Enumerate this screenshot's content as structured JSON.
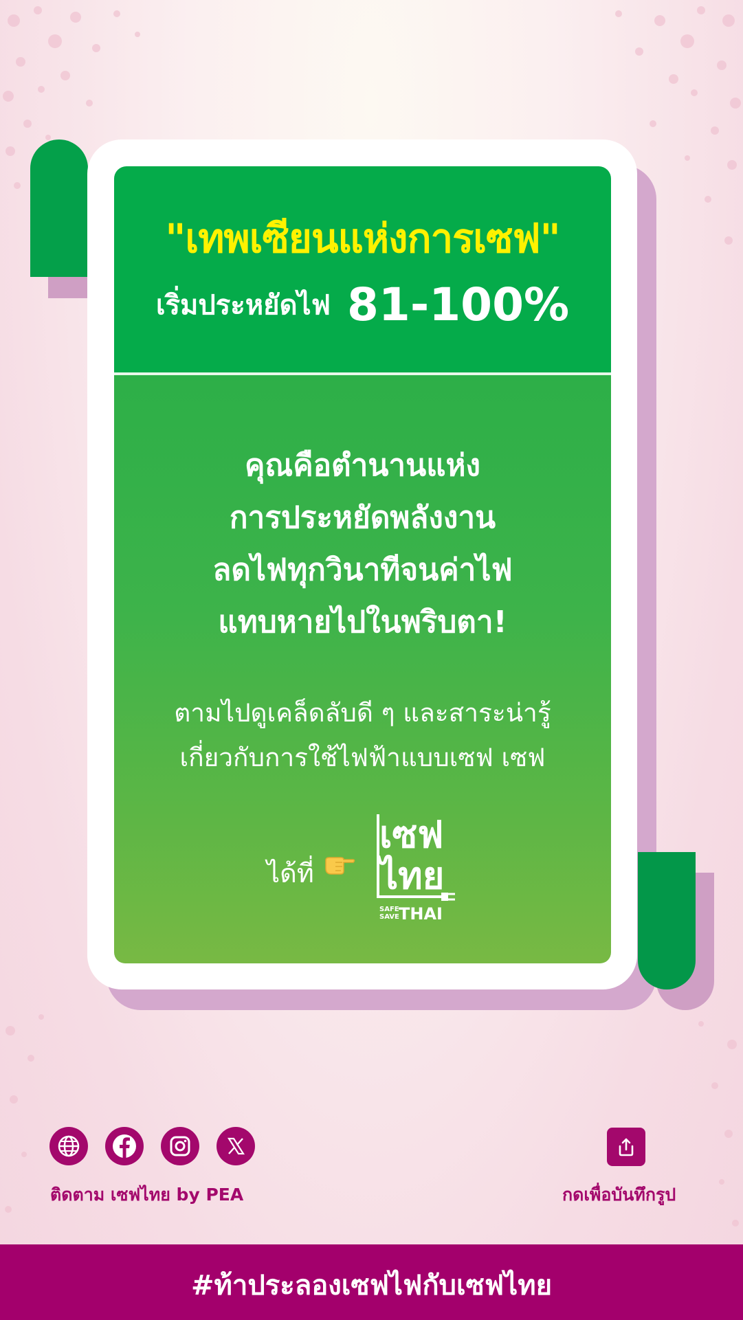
{
  "colors": {
    "green": "#05ab4a",
    "yellow": "#fff200",
    "magenta": "#a3086c",
    "shadow": "#d4a8cd"
  },
  "card": {
    "title": "\"เทพเซียนแห่งการเซฟ\"",
    "subtitle_text": "เริ่มประหยัดไฟ",
    "subtitle_percent": "81-100%",
    "body_lines": [
      "คุณคือตำนานแห่ง",
      "การประหยัดพลังงาน",
      "ลดไฟทุกวินาทีจนค่าไฟ",
      "แทบหายไปในพริบตา!"
    ],
    "follow_lines": [
      "ตามไปดูเคล็ดลับดี ๆ และสาระน่ารู้",
      "เกี่ยวกับการใช้ไฟฟ้าแบบเซฟ เซฟ"
    ],
    "at_label": "ได้ที่",
    "pointer_icon": "pointing-hand-icon",
    "logo": {
      "thai_line1": "เซฟ",
      "thai_line2": "ไทย",
      "small_top": "SAFE",
      "small_bottom": "SAVE",
      "big": "THAI"
    }
  },
  "footer": {
    "social_icons": [
      "globe-icon",
      "facebook-icon",
      "instagram-icon",
      "x-icon"
    ],
    "follow_label": "ติดตาม เซฟไทย by PEA",
    "share_icon": "share-icon",
    "share_label": "กดเพื่อบันทึกรูป",
    "hashtag": "#ท้าประลองเซฟไฟกับเซฟไทย"
  }
}
